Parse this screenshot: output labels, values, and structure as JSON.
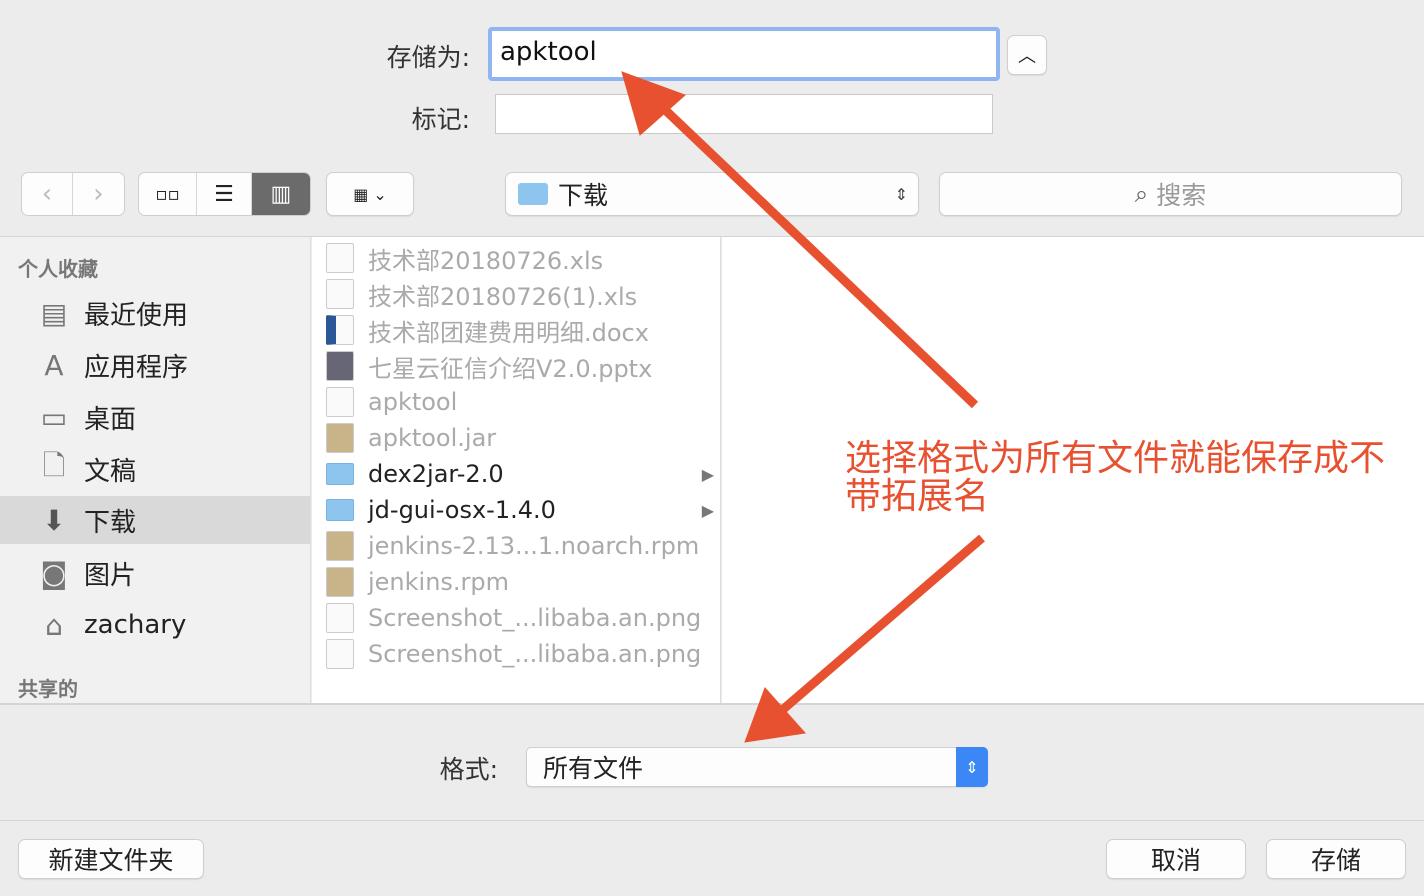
{
  "save_as": {
    "label": "存储为:",
    "value": "apktool"
  },
  "tags": {
    "label": "标记:",
    "value": ""
  },
  "toolbar": {
    "back": "back-icon",
    "forward": "forward-icon",
    "view_modes": [
      "icon-view",
      "list-view",
      "column-view"
    ],
    "active_view": "column-view",
    "location": "下载",
    "search_placeholder": "搜索"
  },
  "sidebar": {
    "favorites_header": "个人收藏",
    "items": [
      {
        "label": "最近使用",
        "icon": "recents-icon"
      },
      {
        "label": "应用程序",
        "icon": "applications-icon"
      },
      {
        "label": "桌面",
        "icon": "desktop-icon"
      },
      {
        "label": "文稿",
        "icon": "documents-icon"
      },
      {
        "label": "下载",
        "icon": "downloads-icon",
        "selected": true
      },
      {
        "label": "图片",
        "icon": "pictures-icon"
      },
      {
        "label": "zachary",
        "icon": "home-icon"
      }
    ],
    "shared_header": "共享的"
  },
  "files": [
    {
      "name": "技术部20180726.xls",
      "type": "file"
    },
    {
      "name": "技术部20180726(1).xls",
      "type": "file"
    },
    {
      "name": "技术部团建费用明细.docx",
      "type": "file"
    },
    {
      "name": "七星云征信介绍V2.0.pptx",
      "type": "file"
    },
    {
      "name": "apktool",
      "type": "file"
    },
    {
      "name": "apktool.jar",
      "type": "file"
    },
    {
      "name": "dex2jar-2.0",
      "type": "folder"
    },
    {
      "name": "jd-gui-osx-1.4.0",
      "type": "folder"
    },
    {
      "name": "jenkins-2.13...1.noarch.rpm",
      "type": "file"
    },
    {
      "name": "jenkins.rpm",
      "type": "file"
    },
    {
      "name": "Screenshot_...libaba.an.png",
      "type": "file"
    },
    {
      "name": "Screenshot_...libaba.an.png",
      "type": "file"
    }
  ],
  "annotation": "选择格式为所有文件就能保存成不带拓展名",
  "format": {
    "label": "格式:",
    "value": "所有文件"
  },
  "buttons": {
    "new_folder": "新建文件夹",
    "cancel": "取消",
    "save": "存储"
  },
  "colors": {
    "annotation": "#e8512f",
    "accent": "#3b87f5"
  }
}
